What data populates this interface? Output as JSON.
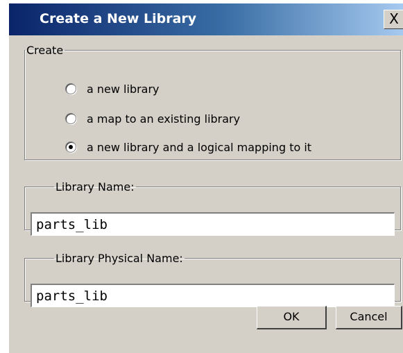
{
  "dialog": {
    "title": "Create a New Library",
    "close_label": "X"
  },
  "create_group": {
    "legend": "Create",
    "options": [
      {
        "label": "a new library",
        "selected": false
      },
      {
        "label": "a map to an existing library",
        "selected": false
      },
      {
        "label": "a new library and a logical mapping to it",
        "selected": true
      }
    ]
  },
  "library_name": {
    "legend": "Library Name:",
    "value": "parts_lib"
  },
  "library_physical_name": {
    "legend": "Library Physical Name:",
    "value": "parts_lib"
  },
  "buttons": {
    "ok": "OK",
    "cancel": "Cancel"
  }
}
